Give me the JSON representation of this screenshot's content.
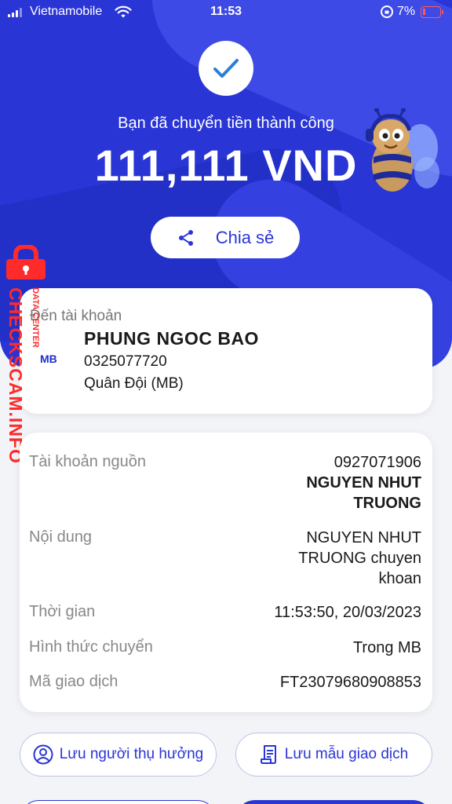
{
  "status_bar": {
    "carrier": "Vietnamobile",
    "time": "11:53",
    "battery": "7%",
    "battery_color": "#ff5a5a"
  },
  "hero": {
    "success_text": "Bạn đã chuyển tiền thành công",
    "amount": "111,111 VND",
    "share_label": "Chia sẻ",
    "background_color": "#2a35d6"
  },
  "watermark": {
    "main": "CHECKSCAM.INFO",
    "sub": "DATA CENTER",
    "color": "#ff2a2a"
  },
  "recipient": {
    "label": "Đến tài khoản",
    "bank_logo": "MB",
    "name": "PHUNG NGOC BAO",
    "account": "0325077720",
    "bank": "Quân Đội (MB)"
  },
  "details": {
    "source_label": "Tài khoản nguồn",
    "source_account": "0927071906",
    "source_name_line1": "NGUYEN NHUT",
    "source_name_line2": "TRUONG",
    "content_label": "Nội dung",
    "content_line1": "NGUYEN NHUT",
    "content_line2": "TRUONG chuyen",
    "content_line3": "khoan",
    "time_label": "Thời gian",
    "time_value": "11:53:50, 20/03/2023",
    "method_label": "Hình thức chuyển",
    "method_value": "Trong MB",
    "txn_label": "Mã giao dịch",
    "txn_value": "FT23079680908853"
  },
  "actions": {
    "save_receiver": "Lưu người thụ hưởng",
    "save_template": "Lưu mẫu giao dịch"
  },
  "icons": [
    "check-icon",
    "share-icon",
    "user-circle-icon",
    "document-icon",
    "wifi-icon",
    "lock-icon"
  ]
}
